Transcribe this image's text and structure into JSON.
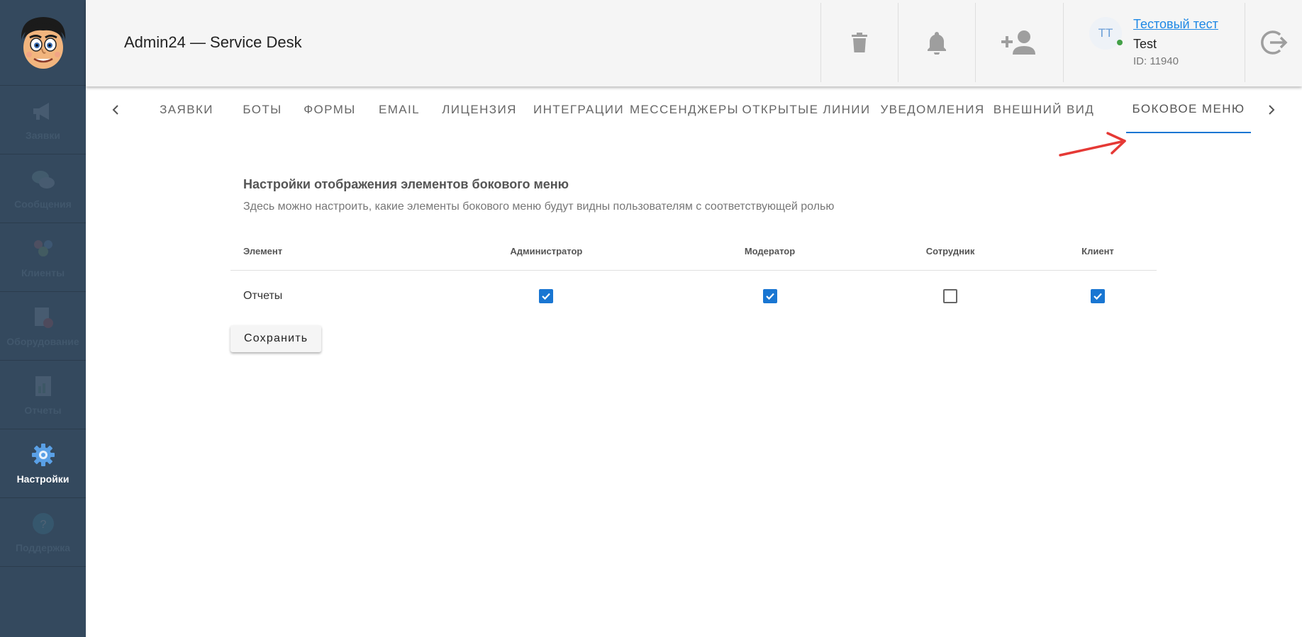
{
  "app": {
    "title": "Admin24 — Service Desk"
  },
  "sidebar": {
    "items": [
      {
        "label": "Заявки",
        "icon": "megaphone-icon",
        "active": false
      },
      {
        "label": "Сообщения",
        "icon": "chat-bubbles-icon",
        "active": false
      },
      {
        "label": "Клиенты",
        "icon": "users-icon",
        "active": false
      },
      {
        "label": "Оборудование",
        "icon": "equipment-icon",
        "active": false
      },
      {
        "label": "Отчеты",
        "icon": "report-icon",
        "active": false
      },
      {
        "label": "Настройки",
        "icon": "gear-icon",
        "active": true
      },
      {
        "label": "Поддержка",
        "icon": "help-icon",
        "active": false
      }
    ]
  },
  "header": {
    "buttons": [
      "trash-icon",
      "bell-icon",
      "add-user-icon",
      "logout-icon"
    ],
    "user": {
      "initials": "ТТ",
      "name": "Тестовый тест",
      "subtitle": "Test",
      "id": "ID: 11940",
      "status_color": "#43a047"
    }
  },
  "tabs": {
    "items": [
      "Заявки",
      "Боты",
      "Формы",
      "Email",
      "Лицензия",
      "Интеграции",
      "Мессенджеры",
      "Открытые линии",
      "Уведомления",
      "Внешний вид",
      "Боковое меню"
    ],
    "active": "Боковое меню",
    "accent": "#1976d2"
  },
  "settings": {
    "title": "Настройки отображения элементов бокового меню",
    "subtitle": "Здесь можно настроить, какие элементы бокового меню будут видны пользователям с соответствующей ролью",
    "columns": [
      "Элемент",
      "Администратор",
      "Модератор",
      "Сотрудник",
      "Клиент"
    ],
    "rows": [
      {
        "element": "Отчеты",
        "checked": [
          true,
          true,
          false,
          true
        ]
      }
    ],
    "save_label": "Сохранить"
  },
  "annotation": {
    "arrow_color": "#e53935"
  }
}
